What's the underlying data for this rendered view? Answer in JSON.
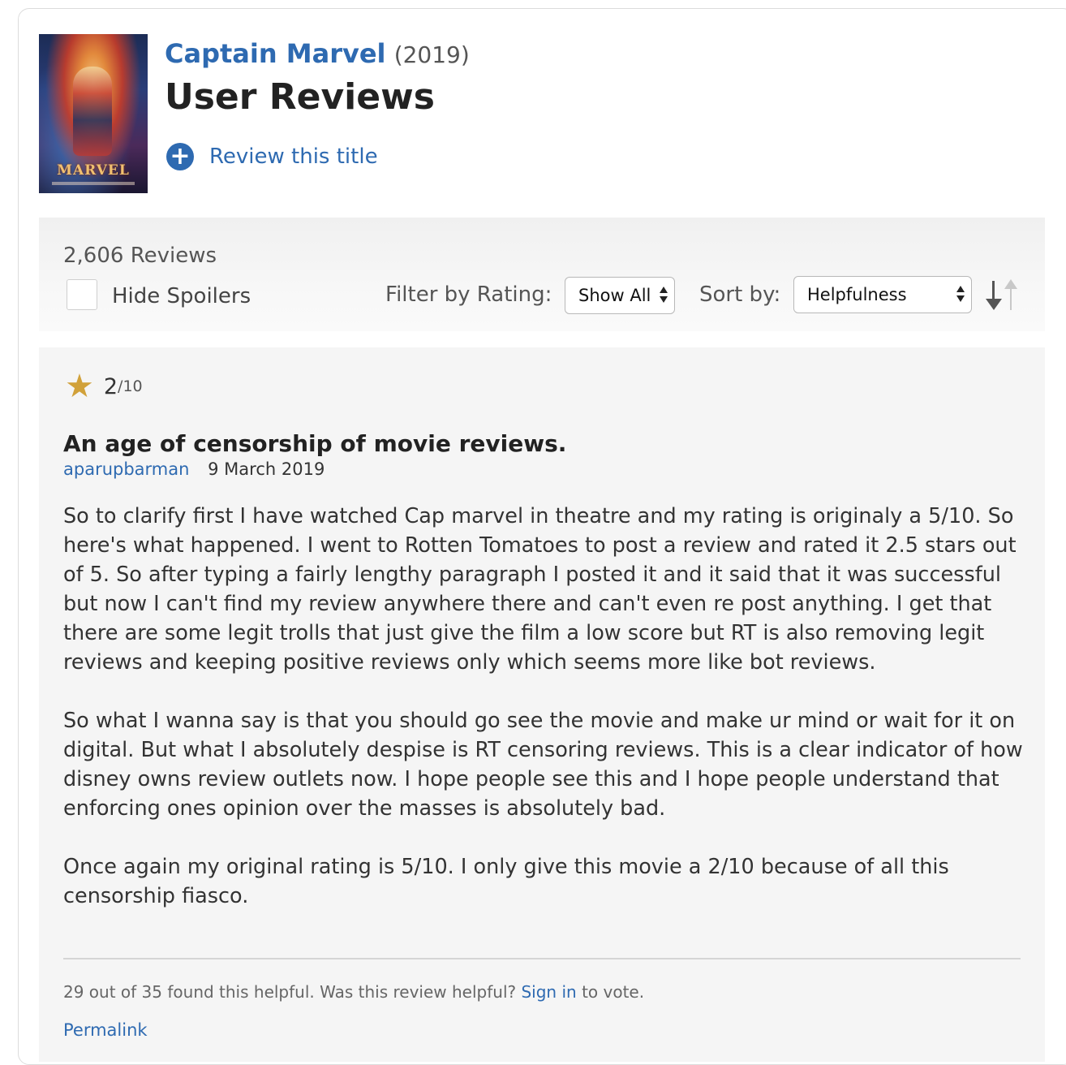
{
  "header": {
    "movie_title": "Captain Marvel",
    "year": "(2019)",
    "page_title": "User Reviews",
    "review_action": "Review this title",
    "poster_logo": "MARVEL"
  },
  "controls": {
    "review_count": "2,606 Reviews",
    "hide_spoilers_label": "Hide Spoilers",
    "hide_spoilers_checked": false,
    "filter_label": "Filter by Rating:",
    "filter_value": "Show All",
    "sort_label": "Sort by:",
    "sort_value": "Helpfulness"
  },
  "review": {
    "rating": "2",
    "rating_scale": "/10",
    "title": "An age of censorship of movie reviews.",
    "author": "aparupbarman",
    "date": "9 March 2019",
    "paragraphs": [
      "So to clarify first I have watched Cap marvel in theatre and my rating is originaly a 5/10. So here's what happened. I went to Rotten Tomatoes to post a review and rated it 2.5 stars out of 5. So after typing a fairly lengthy paragraph I posted it and it said that it was successful but now I can't find my review anywhere there and can't even re post anything. I get that there are some legit trolls that just give the film a low score but RT is also removing legit reviews and keeping positive reviews only which seems more like bot reviews.",
      "So what I wanna say is that you should go see the movie and make ur mind or wait for it on digital. But what I absolutely despise is RT censoring reviews. This is a clear indicator of how disney owns review outlets now. I hope people see this and I hope people understand that enforcing ones opinion over the masses is absolutely bad.",
      "Once again my original rating is 5/10. I only give this movie a 2/10 because of all this censorship fiasco."
    ],
    "helpful_text": "29 out of 35 found this helpful. Was this review helpful?",
    "sign_in": "Sign in",
    "to_vote": "to vote.",
    "permalink": "Permalink"
  },
  "colors": {
    "link_blue": "#2e6ab1",
    "star_gold": "#d1a13a",
    "panel_gray": "#f5f5f5"
  },
  "icons": {
    "add": "plus-circle-icon",
    "rating": "star-icon",
    "sort_direction": "sort-arrows-icon",
    "select": "select-arrows-icon"
  }
}
